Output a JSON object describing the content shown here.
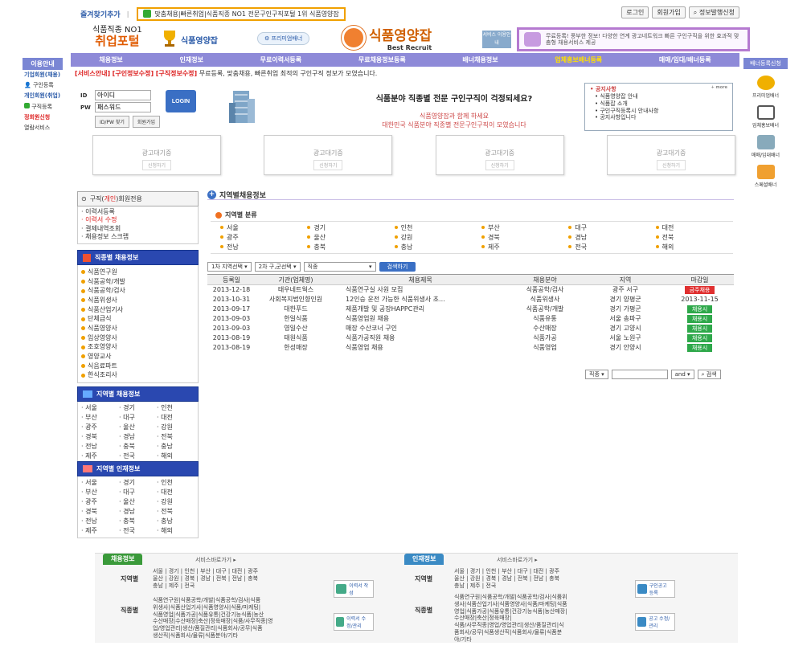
{
  "topbar": {
    "bookmark": "즐겨찾기추가",
    "notice": "맞춤채용|빠른취업|식품직종 NO1 전문구인구직포털 1위 식품영양잡",
    "login": "로그인",
    "join": "회원가입",
    "banner_apply": "정보발행신청"
  },
  "logo": {
    "tagline": "식품직종 NO1",
    "name": "취업포털",
    "brand": "식품영양잡",
    "premium": "프리미엄배너",
    "main_title": "식품영양잡",
    "main_sub": "Best Recruit",
    "svc": "서비스 이용안내",
    "promo": "무료등록! 풍부한 정보! 다양한 연계 광고네트워크 빠른 구인구직을 위한 효과적 맞춤형 채용서비스 제공"
  },
  "nav": [
    "채용정보",
    "인재정보",
    "무료이력서등록",
    "무료채용정보등록",
    "배너채용정보",
    "업체홍보배너등록",
    "매매/임대/배너등록"
  ],
  "left_side": {
    "header": "이용안내",
    "items": [
      "기업회원(채용)",
      "구인등록",
      "개인회원(취업)",
      "구직등록",
      "정회원신청",
      "열람서비스"
    ]
  },
  "right_side": {
    "header": "배너등록신청",
    "items": [
      "프리미엄배너",
      "업체홍보배너",
      "매매/임대배너",
      "스페셜배너"
    ]
  },
  "notice_bar": {
    "a": "[서비스안내]",
    "b": "[구인정보수정]",
    "c": "[구직정보수정]",
    "text": "무료등록, 맞춤채용, 빠른취업 최적의 구인구직 정보가 모였습니다."
  },
  "login": {
    "id_label": "ID",
    "pw_label": "PW",
    "id_value": "아이디",
    "pw_value": "패스워드",
    "login_btn": "LOGIN",
    "find_btn": "ID/PW 찾기",
    "join_btn": "회원가입"
  },
  "headline": {
    "h1": "식품분야 직종별 전문 구인구직이 걱정되세요?",
    "h2a": "식품영양잡과 함께 하세요",
    "h2b": "대한민국 식품분야 직종별 전문구인구직이 모였습니다"
  },
  "notices": {
    "title": "공지사항",
    "more": "+ more",
    "items": [
      "식품영양잡 안내",
      "식품잡 소개",
      "구인구직등록시 안내사항",
      "공지사항입니다"
    ]
  },
  "ads": [
    {
      "t": "광고대기중",
      "b": "신청하기"
    },
    {
      "t": "광고대기중",
      "b": "신청하기"
    },
    {
      "t": "광고대기중",
      "b": "신청하기"
    },
    {
      "t": "광고대기중",
      "b": "신청하기"
    }
  ],
  "member": {
    "pre": "구직(",
    "red": "개인",
    "post": ")회원전용",
    "items": [
      "이력서등록",
      "이력서 수정",
      "결제내역조회",
      "채용정보 스크랩"
    ]
  },
  "jobcat": {
    "title": "직종별 채용정보",
    "items": [
      "식품연구원",
      "식품공학/개발",
      "식품공학/검사",
      "식품위생사",
      "식품산업기사",
      "단체급식",
      "식품영양사",
      "임상영양사",
      "조호영양사",
      "영양교사",
      "식음료파트",
      "한식조리사"
    ]
  },
  "region_jobs": {
    "title": "지역별 채용정보",
    "items": [
      "서울",
      "경기",
      "인천",
      "부산",
      "대구",
      "대전",
      "광주",
      "울산",
      "강원",
      "경북",
      "경남",
      "전북",
      "전남",
      "충북",
      "충남",
      "제주",
      "전국",
      "해외"
    ]
  },
  "region_talent": {
    "title": "지역별 인재정보",
    "items": [
      "서울",
      "경기",
      "인천",
      "부산",
      "대구",
      "대전",
      "광주",
      "울산",
      "강원",
      "경북",
      "경남",
      "전북",
      "전남",
      "충북",
      "충남",
      "제주",
      "전국",
      "해외"
    ]
  },
  "regional": {
    "title": "지역별채용정보",
    "subtitle": "지역별 분류",
    "regions": [
      "서울",
      "경기",
      "인천",
      "부산",
      "대구",
      "대전",
      "광주",
      "울산",
      "강원",
      "경북",
      "경남",
      "전북",
      "전남",
      "충북",
      "충남",
      "제주",
      "전국",
      "해외"
    ]
  },
  "filters": {
    "f1": "1차 지역선택",
    "f2": "2차 구,군선택",
    "f3": "직종",
    "search": "검색하기"
  },
  "table": {
    "headers": [
      "등록일",
      "기관(업체명)",
      "채용제목",
      "채용분야",
      "지역",
      "마감일"
    ],
    "rows": [
      {
        "date": "2013-12-18",
        "company": "태우네트웍스",
        "title": "식품연구실 사원 모집",
        "field": "식품공학/검사",
        "region": "광주 서구",
        "deadline": "금주채용",
        "red": true
      },
      {
        "date": "2013-10-31",
        "company": "사회복지법인향인원",
        "title": "12인승 운전 가능한 식품위생사 초...",
        "field": "식품위생사",
        "region": "경기 양평군",
        "deadline": "2013-11-15",
        "plain": true
      },
      {
        "date": "2013-09-17",
        "company": "대한푸드",
        "title": "제품개발 및 공장HAPPC관리",
        "field": "식품공학/개발",
        "region": "경기 가평군",
        "deadline": "채용시"
      },
      {
        "date": "2013-09-03",
        "company": "한일식품",
        "title": "식품영업원 채용",
        "field": "식품유통",
        "region": "서울 송파구",
        "deadline": "채용시"
      },
      {
        "date": "2013-09-03",
        "company": "영일수산",
        "title": "매장 수산코너 구인",
        "field": "수산매장",
        "region": "경기 고양시",
        "deadline": "채용시"
      },
      {
        "date": "2013-08-19",
        "company": "태원식품",
        "title": "식품가공직원 채용",
        "field": "식품가공",
        "region": "서울 노원구",
        "deadline": "채용시"
      },
      {
        "date": "2013-08-19",
        "company": "한성매장",
        "title": "식품영업 채용",
        "field": "식품영업",
        "region": "경기 안양시",
        "deadline": "채용시"
      }
    ]
  },
  "bottom_search": {
    "sel1": "직종",
    "sel2": "and",
    "btn": "검색"
  },
  "bottom": {
    "job_tab": "채용정보",
    "talent_tab": "인재정보",
    "shortcut": "서비스바로가기 ▸",
    "region_label": "지역별",
    "job_label": "직종별",
    "job_regions": "서울 | 경기 | 인천 | 부산 | 대구 | 대전 | 광주\n울산 | 강원 | 경북 | 경남 | 전북 | 전남 | 충북\n충남 | 제주 | 전국",
    "job_jobs": "식품연구원|식품공학/개발|식품공학/검사|식품\n위생사|식품산업기사|식품영양사|식품/마케팅|\n식품영업|식품가공|식품유통|건강기능식품|농산\n수산매장|수산매장|축산|정육매장|식품/사무직종|영\n업/영업관리|생산/품질관리|식품회사/공무|식품\n생산직|식품회사/물류|식품분야/기타",
    "talent_regions": "서울 | 경기 | 인천 | 부산 | 대구 | 대전 | 광주\n울산 | 강원 | 경북 | 경남 | 전북 | 전남 | 충북\n충남 | 제주 | 전국",
    "talent_jobs": "식품연구원|식품공학/개발|식품공학/검사|식품위\n생사|식품산업기사|식품영양사|식품/마케팅|식품\n영업|식품가공|식품유통|건강기능식품|농산매장|\n수산매장|축산|정육매장|\n식품/사무직종|영업/영업관리|생산/품질관리|식\n품회사/공무|식품생산직|식품회사/물류|식품분\n야/기타",
    "btn1": "이력서 작성",
    "btn2": "이력서 수정/관리",
    "btn3": "구인공고 등록",
    "btn4": "공고 수정/관리"
  }
}
